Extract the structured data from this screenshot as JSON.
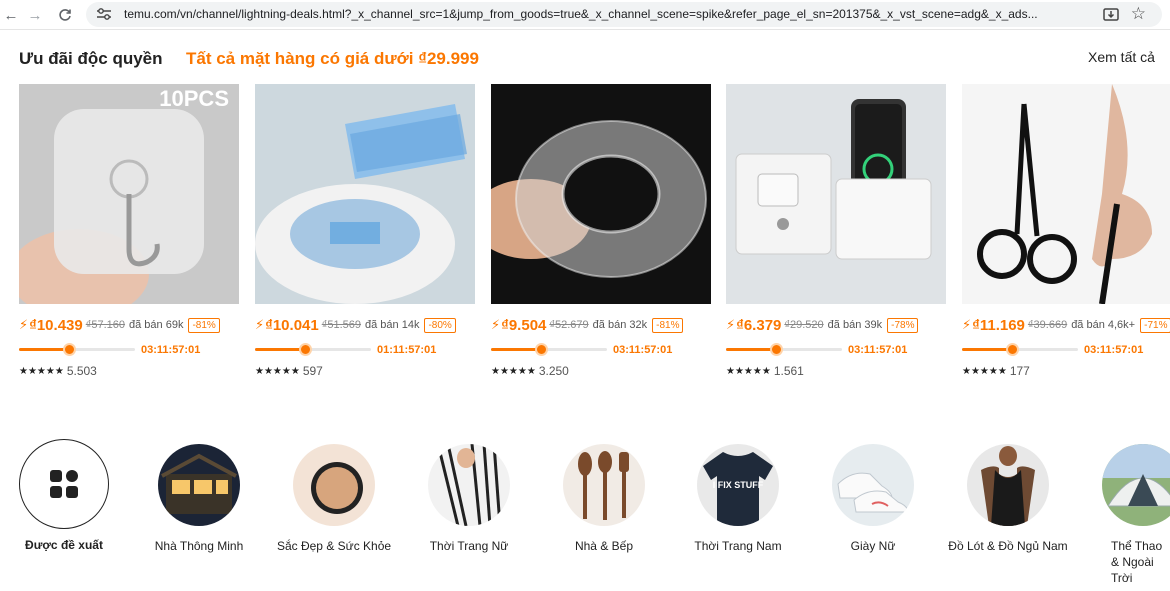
{
  "browser": {
    "url": "temu.com/vn/channel/lightning-deals.html?_x_channel_src=1&jump_from_goods=true&_x_channel_scene=spike&refer_page_el_sn=201375&_x_vst_scene=adg&_x_ads..."
  },
  "section": {
    "title": "Ưu đãi độc quyền",
    "subtitle": "Tất cả mặt hàng có giá dưới ₫29.999",
    "see_all": "Xem tất cả"
  },
  "products": [
    {
      "image_label": "10PCS",
      "icon": "adhesive-hook-icon",
      "price": "₫10.439",
      "old_price": "₫57.160",
      "sold": "đã bán 69k",
      "discount": "-81%",
      "progress": 0.43,
      "countdown": "03:11:57:01",
      "stars": "★★★★★",
      "rating_count": "5.503"
    },
    {
      "icon": "toilet-paper-sheets-icon",
      "price": "₫10.041",
      "old_price": "₫51.569",
      "sold": "đã bán 14k",
      "discount": "-80%",
      "progress": 0.43,
      "countdown": "01:11:57:01",
      "stars": "★★★★★",
      "rating_count": "597"
    },
    {
      "icon": "nano-tape-icon",
      "price": "₫9.504",
      "old_price": "₫52.679",
      "sold": "đã bán 32k",
      "discount": "-81%",
      "progress": 0.43,
      "countdown": "03:11:57:01",
      "stars": "★★★★★",
      "rating_count": "3.250"
    },
    {
      "icon": "phone-wall-holder-icon",
      "price": "₫6.379",
      "old_price": "₫29.520",
      "sold": "đã bán 39k",
      "discount": "-78%",
      "progress": 0.43,
      "countdown": "03:11:57:01",
      "stars": "★★★★★",
      "rating_count": "1.561"
    },
    {
      "icon": "nose-scissors-icon",
      "price": "₫11.169",
      "old_price": "₫39.669",
      "sold": "đã bán 4,6k+",
      "discount": "-71%",
      "progress": 0.43,
      "countdown": "03:11:57:01",
      "stars": "★★★★★",
      "rating_count": "177"
    }
  ],
  "categories": [
    {
      "label": "Được đề xuất",
      "icon": "grid-icon",
      "selected": true
    },
    {
      "label": "Nhà Thông Minh",
      "icon": "smart-home-icon"
    },
    {
      "label": "Sắc Đẹp & Sức Khỏe",
      "icon": "makeup-compact-icon"
    },
    {
      "label": "Thời Trang Nữ",
      "icon": "striped-blouse-icon"
    },
    {
      "label": "Nhà & Bếp",
      "icon": "wooden-utensils-icon"
    },
    {
      "label": "Thời Trang Nam",
      "icon": "tshirt-icon",
      "image_text": "I FIX STUFF"
    },
    {
      "label": "Giày Nữ",
      "icon": "sneakers-icon"
    },
    {
      "label": "Đồ Lót & Đồ Ngủ Nam",
      "icon": "tank-top-icon"
    },
    {
      "label": "Thể Thao & Ngoài Trời",
      "icon": "tent-icon"
    }
  ],
  "colors": {
    "accent": "#fb7701"
  }
}
